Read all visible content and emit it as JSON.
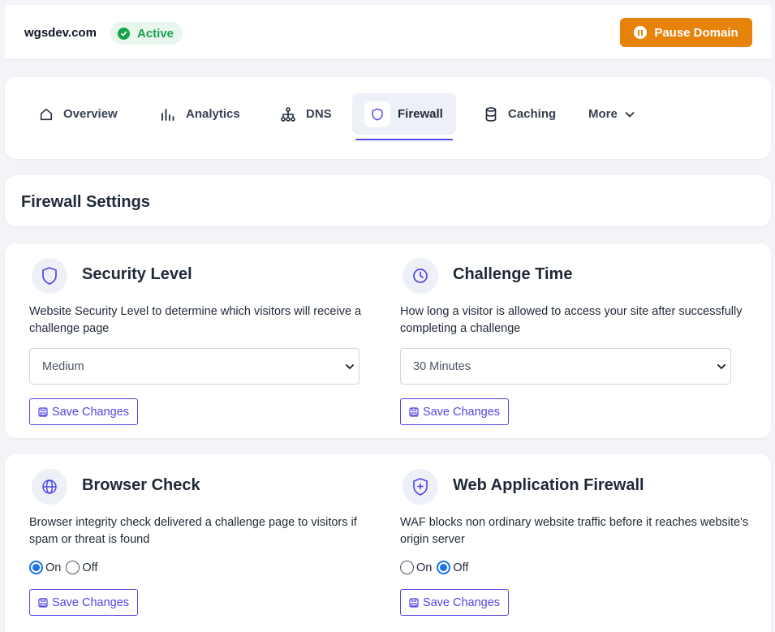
{
  "header": {
    "domain": "wgsdev.com",
    "status": "Active",
    "pause_label": "Pause Domain"
  },
  "nav": {
    "tabs": [
      {
        "label": "Overview",
        "icon": "home-icon"
      },
      {
        "label": "Analytics",
        "icon": "bar-chart-icon"
      },
      {
        "label": "DNS",
        "icon": "network-icon"
      },
      {
        "label": "Firewall",
        "icon": "shield-icon",
        "active": true
      },
      {
        "label": "Caching",
        "icon": "database-icon"
      },
      {
        "label": "More",
        "icon": "chevron-down-icon"
      }
    ]
  },
  "page": {
    "title": "Firewall Settings"
  },
  "settings": {
    "security_level": {
      "title": "Security Level",
      "description": "Website Security Level to determine which visitors will receive a challenge page",
      "selected": "Medium",
      "save_label": "Save Changes"
    },
    "challenge_time": {
      "title": "Challenge Time",
      "description": "How long a visitor is allowed to access your site after successfully completing a challenge",
      "selected": "30 Minutes",
      "save_label": "Save Changes"
    },
    "browser_check": {
      "title": "Browser Check",
      "description": "Browser integrity check delivered a challenge page to visitors if spam or threat is found",
      "on_label": "On",
      "off_label": "Off",
      "value": "On",
      "save_label": "Save Changes"
    },
    "waf": {
      "title": "Web Application Firewall",
      "description": "WAF blocks non ordinary website traffic before it reaches website's origin server",
      "on_label": "On",
      "off_label": "Off",
      "value": "Off",
      "save_label": "Save Changes"
    }
  },
  "colors": {
    "accent": "#4f46e5",
    "active_green": "#16a34a",
    "pause_orange": "#e7830b",
    "radio_blue": "#1a73e8"
  }
}
